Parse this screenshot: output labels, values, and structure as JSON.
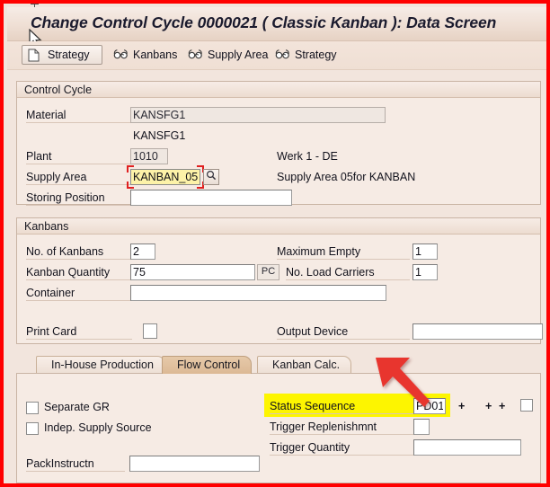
{
  "window": {
    "title": "Change Control Cycle 0000021 ( Classic Kanban ): Data Screen"
  },
  "toolbar": {
    "buttons": [
      {
        "label": "Strategy",
        "icon": "document-icon",
        "framed": true
      },
      {
        "label": "Kanbans",
        "icon": "glasses-icon",
        "framed": false
      },
      {
        "label": "Supply Area",
        "icon": "glasses-icon",
        "framed": false
      },
      {
        "label": "Strategy",
        "icon": "glasses-icon",
        "framed": false
      }
    ]
  },
  "control_cycle": {
    "header": "Control Cycle",
    "material_label": "Material",
    "material_value": "KANSFG1",
    "material_desc": "KANSFG1",
    "plant_label": "Plant",
    "plant_value": "1010",
    "plant_desc": "Werk 1 - DE",
    "supply_area_label": "Supply Area",
    "supply_area_value": "KANBAN_05",
    "supply_area_desc": "Supply Area 05for KANBAN",
    "search_icon": "magnifier-icon",
    "storing_position_label": "Storing Position",
    "storing_position_value": ""
  },
  "kanbans": {
    "header": "Kanbans",
    "no_of_kanbans_label": "No. of Kanbans",
    "no_of_kanbans_value": "2",
    "maximum_empty_label": "Maximum Empty",
    "maximum_empty_value": "1",
    "kanban_quantity_label": "Kanban Quantity",
    "kanban_quantity_value": "75",
    "kanban_quantity_unit": "PC",
    "no_load_carriers_label": "No. Load Carriers",
    "no_load_carriers_value": "1",
    "container_label": "Container",
    "container_value": "",
    "print_card_label": "Print Card",
    "output_device_label": "Output Device",
    "output_device_value": ""
  },
  "tabs": [
    {
      "label": "In-House Production",
      "active": false
    },
    {
      "label": "Flow Control",
      "active": true
    },
    {
      "label": "Kanban Calc.",
      "active": false
    }
  ],
  "flow_control": {
    "separate_gr_label": "Separate GR",
    "indep_supply_source_label": "Indep. Supply Source",
    "pack_instructn_label": "PackInstructn",
    "pack_instructn_value": "",
    "status_sequence_label": "Status Sequence",
    "status_sequence_value": "PD01",
    "plus_1": "+",
    "plus_2": "+",
    "plus_3": "+",
    "trigger_replenishmnt_label": "Trigger Replenishmnt",
    "trigger_replenishmnt_value": "",
    "trigger_quantity_label": "Trigger Quantity",
    "trigger_quantity_value": ""
  },
  "annotation": {
    "arrow": "red-arrow-annotation",
    "highlight_color": "#fdf500",
    "border_color": "#ff0000"
  }
}
